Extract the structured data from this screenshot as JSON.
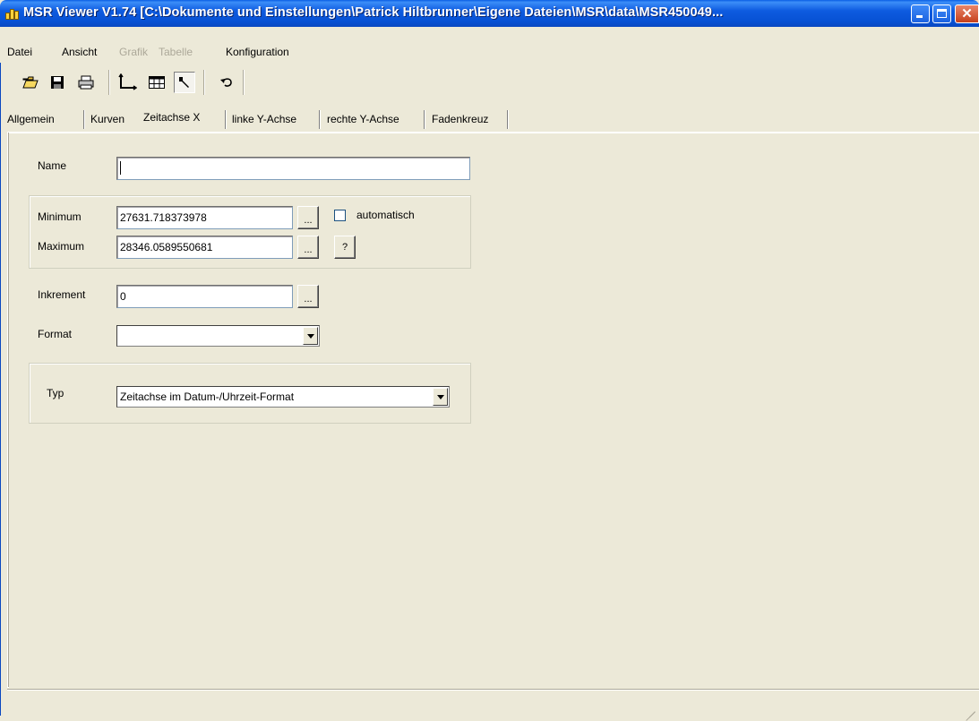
{
  "window": {
    "title": "MSR Viewer V1.74 [C:\\Dokumente und Einstellungen\\Patrick Hiltbrunner\\Eigene Dateien\\MSR\\data\\MSR450049...",
    "app_icon": "msr-app-icon",
    "buttons": {
      "minimize": "minimize-icon",
      "maximize": "maximize-icon",
      "close": "✕"
    }
  },
  "menu": {
    "items": [
      {
        "label": "Datei",
        "enabled": true
      },
      {
        "label": "Ansicht",
        "enabled": true
      },
      {
        "label": "Grafik",
        "enabled": false
      },
      {
        "label": "Tabelle",
        "enabled": false
      },
      {
        "label": "Konfiguration",
        "enabled": true
      }
    ]
  },
  "toolbar": {
    "tools": [
      {
        "icon": "open-folder-icon"
      },
      {
        "icon": "save-disk-icon"
      },
      {
        "icon": "printer-icon"
      },
      {
        "icon": "axes-icon"
      },
      {
        "icon": "table-icon"
      },
      {
        "icon": "wrench-icon",
        "pressed": true
      },
      {
        "icon": "undo-icon"
      }
    ]
  },
  "tabs": {
    "items": [
      "Allgemein",
      "Kurven",
      "Zeitachse X",
      "linke Y-Achse",
      "rechte Y-Achse",
      "Fadenkreuz"
    ],
    "active": "Zeitachse X"
  },
  "form": {
    "name_label": "Name",
    "name_value": "",
    "minimum_label": "Minimum",
    "minimum_value": "27631.718373978",
    "maximum_label": "Maximum",
    "maximum_value": "28346.0589550681",
    "automatisch_label": "automatisch",
    "automatisch_checked": false,
    "question_button": "?",
    "ellipsis_button": "...",
    "inkrement_label": "Inkrement",
    "inkrement_value": "0",
    "format_label": "Format",
    "format_value": "",
    "typ_label": "Typ",
    "typ_value": "Zeitachse im Datum-/Uhrzeit-Format"
  }
}
